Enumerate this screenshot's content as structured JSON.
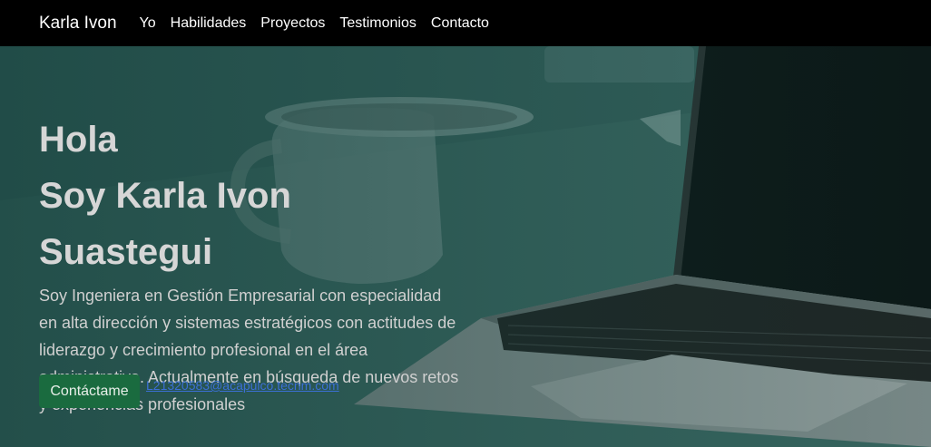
{
  "navbar": {
    "brand": "Karla Ivon",
    "links": [
      "Yo",
      "Habilidades",
      "Proyectos",
      "Testimonios",
      "Contacto"
    ]
  },
  "hero": {
    "title_line1": "Hola",
    "title_line2": "Soy Karla Ivon Suastegui",
    "description": "Soy Ingeniera en Gestión Empresarial con especialidad en alta dirección y sistemas estratégicos con actitudes de liderazgo y crecimiento profesional en el área administrativa. Actualmente en búsqueda de nuevos retos y experiencias profesionales",
    "contact_button": "Contáctame",
    "email": "L21320583@acapulco.tecnm.com"
  },
  "colors": {
    "navbar": "#000000",
    "button": "#1a6b3f",
    "link": "#3b6fd6"
  }
}
